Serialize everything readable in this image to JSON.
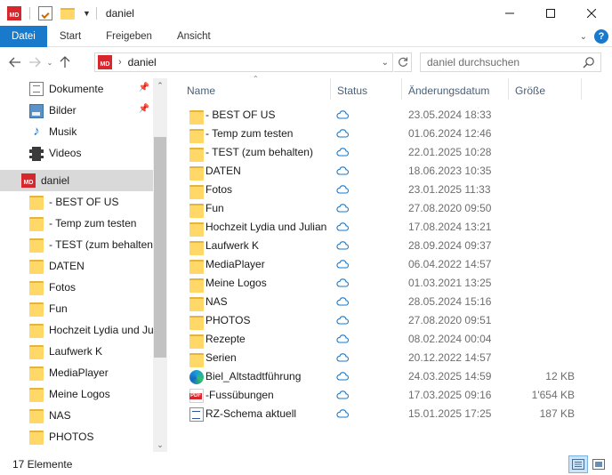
{
  "window": {
    "title": "daniel",
    "app_logo_text": "MD",
    "controls": [
      "minimize",
      "maximize",
      "close"
    ]
  },
  "ribbon": {
    "tabs": [
      "Datei",
      "Start",
      "Freigeben",
      "Ansicht"
    ],
    "help_label": "?"
  },
  "navigation": {
    "address_path": "daniel",
    "search_placeholder": "daniel durchsuchen"
  },
  "nav_pane": {
    "quick_access": [
      {
        "label": "Dokumente",
        "icon": "documents-icon",
        "pinned": true
      },
      {
        "label": "Bilder",
        "icon": "pictures-icon",
        "pinned": true
      },
      {
        "label": "Musik",
        "icon": "music-icon",
        "pinned": false
      },
      {
        "label": "Videos",
        "icon": "videos-icon",
        "pinned": false
      }
    ],
    "selected": {
      "label": "daniel",
      "icon": "md-folder-icon"
    },
    "folders": [
      "- BEST OF US",
      "- Temp zum testen",
      "- TEST (zum behalten)",
      "DATEN",
      "Fotos",
      "Fun",
      "Hochzeit Lydia und Jul",
      "Laufwerk K",
      "MediaPlayer",
      "Meine Logos",
      "NAS",
      "PHOTOS"
    ]
  },
  "columns": {
    "name": "Name",
    "status": "Status",
    "date": "Änderungsdatum",
    "size": "Größe"
  },
  "files": [
    {
      "name": "- BEST OF US",
      "type": "folder",
      "status": "cloud",
      "date": "23.05.2024 18:33",
      "size": ""
    },
    {
      "name": "- Temp zum testen",
      "type": "folder",
      "status": "cloud",
      "date": "01.06.2024 12:46",
      "size": ""
    },
    {
      "name": "- TEST (zum behalten)",
      "type": "folder",
      "status": "cloud",
      "date": "22.01.2025 10:28",
      "size": ""
    },
    {
      "name": "DATEN",
      "type": "folder",
      "status": "cloud",
      "date": "18.06.2023 10:35",
      "size": ""
    },
    {
      "name": "Fotos",
      "type": "folder",
      "status": "cloud",
      "date": "23.01.2025 11:33",
      "size": ""
    },
    {
      "name": "Fun",
      "type": "folder",
      "status": "cloud",
      "date": "27.08.2020 09:50",
      "size": ""
    },
    {
      "name": "Hochzeit Lydia und Julian",
      "type": "folder",
      "status": "cloud",
      "date": "17.08.2024 13:21",
      "size": ""
    },
    {
      "name": "Laufwerk K",
      "type": "folder",
      "status": "cloud",
      "date": "28.09.2024 09:37",
      "size": ""
    },
    {
      "name": "MediaPlayer",
      "type": "folder",
      "status": "cloud",
      "date": "06.04.2022 14:57",
      "size": ""
    },
    {
      "name": "Meine Logos",
      "type": "folder",
      "status": "cloud",
      "date": "01.03.2021 13:25",
      "size": ""
    },
    {
      "name": "NAS",
      "type": "folder",
      "status": "cloud",
      "date": "28.05.2024 15:16",
      "size": ""
    },
    {
      "name": "PHOTOS",
      "type": "folder",
      "status": "cloud",
      "date": "27.08.2020 09:51",
      "size": ""
    },
    {
      "name": "Rezepte",
      "type": "folder",
      "status": "cloud",
      "date": "08.02.2024 00:04",
      "size": ""
    },
    {
      "name": "Serien",
      "type": "folder",
      "status": "cloud",
      "date": "20.12.2022 14:57",
      "size": ""
    },
    {
      "name": "Biel_Altstadtführung",
      "type": "edge",
      "status": "cloud",
      "date": "24.03.2025 14:59",
      "size": "12 KB"
    },
    {
      "name": "-Fussübungen",
      "type": "pdf",
      "status": "cloud",
      "date": "17.03.2025 09:16",
      "size": "1'654 KB"
    },
    {
      "name": "RZ-Schema aktuell",
      "type": "doc",
      "status": "cloud",
      "date": "15.01.2025 17:25",
      "size": "187 KB"
    }
  ],
  "status_bar": {
    "item_count": "17 Elemente"
  },
  "colors": {
    "accent": "#1979ca",
    "folder": "#ffd868",
    "cloud": "#1979ca",
    "selected_bg": "#d9d9d9"
  }
}
